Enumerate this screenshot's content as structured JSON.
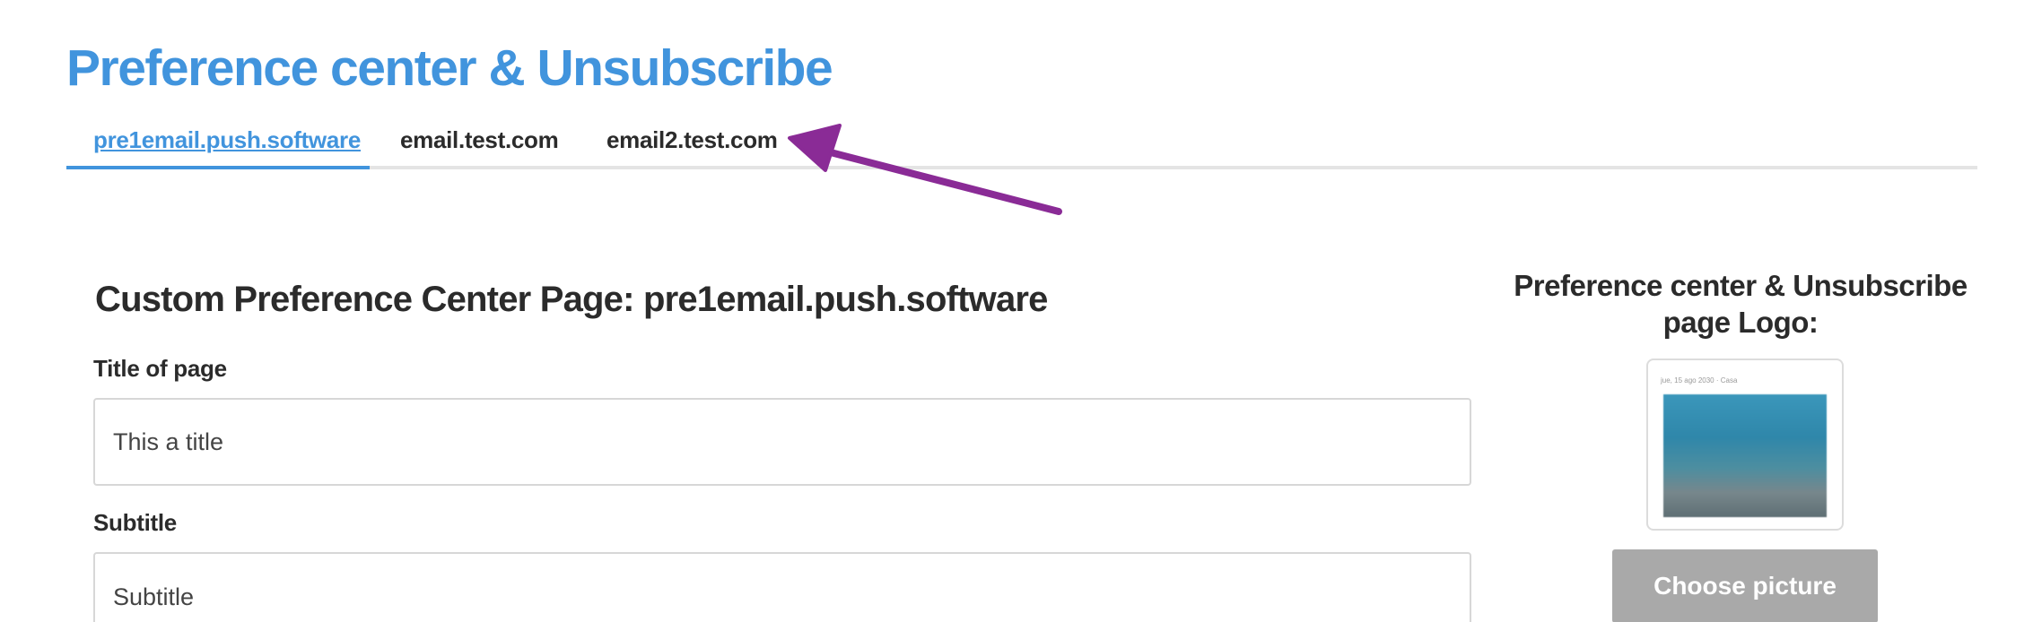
{
  "header": {
    "title": "Preference center & Unsubscribe",
    "accent_color": "#4194dd"
  },
  "tabs": [
    {
      "label": "pre1email.push.software",
      "active": true
    },
    {
      "label": "email.test.com",
      "active": false
    },
    {
      "label": "email2.test.com",
      "active": false
    }
  ],
  "annotation": {
    "arrow_color": "#8a2b96"
  },
  "form": {
    "section_title": "Custom Preference Center Page: pre1email.push.software",
    "title_label": "Title of page",
    "title_value": "This a title",
    "subtitle_label": "Subtitle",
    "subtitle_value": "Subtitle"
  },
  "logo_panel": {
    "heading_line1": "Preference center & Unsubscribe",
    "heading_line2": "page Logo:",
    "preview_caption": "jue, 15 ago 2030 · Casa",
    "choose_button": "Choose picture",
    "button_color": "#a9a9a9"
  }
}
